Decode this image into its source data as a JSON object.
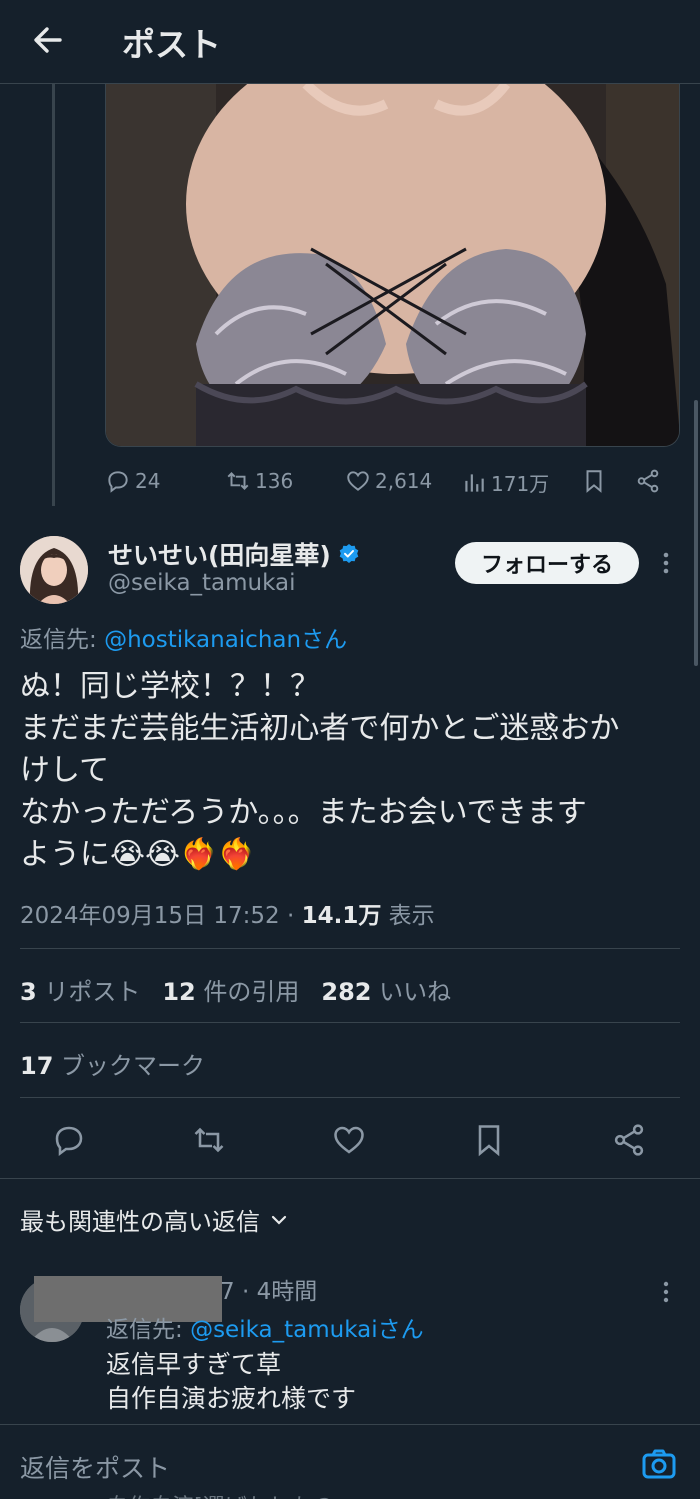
{
  "header": {
    "title": "ポスト"
  },
  "prev_post": {
    "actions": {
      "replies": "24",
      "reposts": "136",
      "likes": "2,614",
      "views": "171万"
    }
  },
  "post": {
    "author_name": "せいせい(田向星華)",
    "author_handle": "@seika_tamukai",
    "follow_label": "フォローする",
    "reply_to_prefix": "返信先: ",
    "reply_to_mention": "@hostikanaichanさん",
    "body": "ぬ！同じ学校！？！？\nまだまだ芸能生活初心者で何かとご迷惑おか\nけして\nなかっただろうか。。。またお会いできます\nように😭😭❤️‍🔥❤️‍🔥",
    "timestamp": "2024年09月15日 17:52 · ",
    "views_count": "14.1万",
    "views_label": " 表示",
    "stats": {
      "reposts_count": "3",
      "reposts_label": " リポスト",
      "quotes_count": "12",
      "quotes_label": " 件の引用",
      "likes_count": "282",
      "likes_label": " いいね",
      "bookmarks_count": "17",
      "bookmarks_label": " ブックマーク"
    }
  },
  "replies_section": {
    "sort_label": "最も関連性の高い返信",
    "reply": {
      "meta": "7 · 4時間",
      "reply_to_prefix": "返信先: ",
      "reply_to_mention": "@seika_tamukaiさん",
      "text": "返信早すぎて草\n自作自演お疲れ様です"
    }
  },
  "composer": {
    "placeholder": "返信をポスト",
    "below_text": "自作自演[選ばれしもの"
  },
  "colors": {
    "background": "#15202b",
    "accent": "#1d9bf0",
    "muted": "#8b98a5",
    "divider": "#38444d"
  }
}
